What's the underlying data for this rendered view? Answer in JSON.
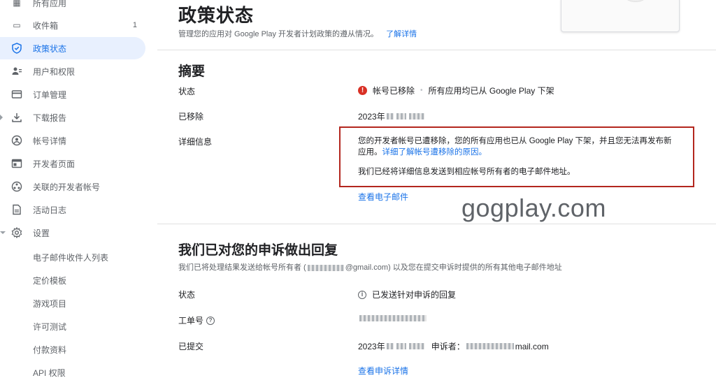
{
  "sidebar": {
    "items": [
      {
        "label": "所有应用",
        "icon": "apps-grid-icon",
        "glyph": "▦"
      },
      {
        "label": "收件箱",
        "icon": "inbox-icon",
        "glyph": "▭",
        "badge": "1"
      },
      {
        "label": "政策状态",
        "icon": "shield-check-icon",
        "glyph": "⛉",
        "active": true
      },
      {
        "label": "用户和权限",
        "icon": "users-icon",
        "glyph": "👥"
      },
      {
        "label": "订单管理",
        "icon": "credit-card-icon",
        "glyph": "▬"
      },
      {
        "label": "下载报告",
        "icon": "download-icon",
        "glyph": "⤓"
      },
      {
        "label": "帐号详情",
        "icon": "account-circle-icon",
        "glyph": "◉"
      },
      {
        "label": "开发者页面",
        "icon": "web-page-icon",
        "glyph": "▤"
      },
      {
        "label": "关联的开发者帐号",
        "icon": "linked-accounts-icon",
        "glyph": "⚇"
      },
      {
        "label": "活动日志",
        "icon": "activity-log-icon",
        "glyph": "▯"
      },
      {
        "label": "设置",
        "icon": "gear-icon",
        "glyph": "⚙"
      }
    ],
    "sub_items": [
      "电子邮件收件人列表",
      "定价模板",
      "游戏项目",
      "许可测试",
      "付款资料",
      "API 权限"
    ]
  },
  "header": {
    "title": "政策状态",
    "description": "管理您的应用对 Google Play 开发者计划政策的遵从情况。",
    "learn_more": "了解详情"
  },
  "summary": {
    "title": "摘要",
    "status_label": "状态",
    "status_value": "帐号已移除",
    "status_detail": "所有应用均已从 Google Play 下架",
    "removed_label": "已移除",
    "removed_date": "2023年",
    "details_label": "详细信息",
    "details_text_1": "您的开发者帐号已遭移除，您的所有应用也已从 Google Play 下架，并且您无法再发布新应用。",
    "details_link": "详细了解帐号遭移除的原因。",
    "details_text_2": "我们已经将详细信息发送到相应帐号所有者的电子邮件地址。",
    "view_email": "查看电子邮件"
  },
  "watermark": "gogplay.com",
  "appeal": {
    "title": "我们已对您的申诉做出回复",
    "description_prefix": "我们已将处理结果发送给帐号所有者 (",
    "email_suffix": "@gmail.com",
    "description_suffix": ") 以及您在提交申诉时提供的所有其他电子邮件地址",
    "status_label": "状态",
    "status_value": "已发送针对申诉的回复",
    "ticket_label": "工单号",
    "submitted_label": "已提交",
    "submitted_date": "2023年",
    "appellant_label": "申诉者：",
    "appellant_email_suffix": "mail.com",
    "view_appeal": "查看申诉详情"
  },
  "colors": {
    "accent": "#1a73e8",
    "error": "#d93025",
    "highlight_box": "#b3261e"
  }
}
